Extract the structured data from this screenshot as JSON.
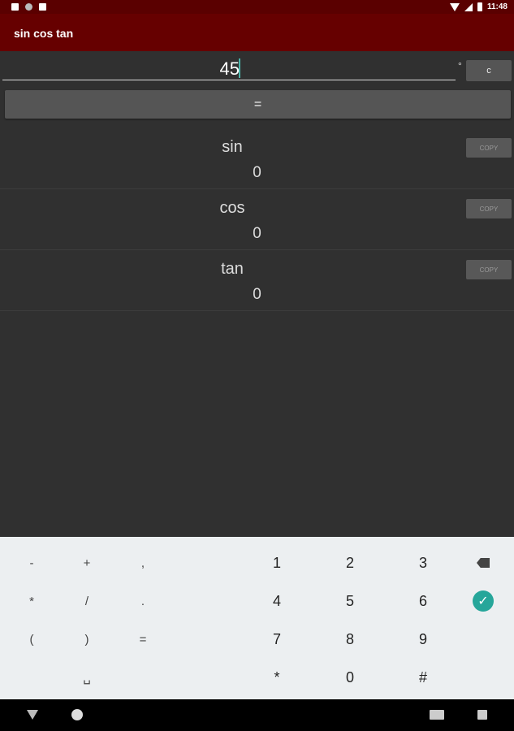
{
  "status_bar": {
    "time": "11:48"
  },
  "app": {
    "title": "sin cos tan"
  },
  "input": {
    "value": "45",
    "degree_symbol": "°",
    "clear_label": "c"
  },
  "equals_label": "=",
  "results": [
    {
      "label": "sin",
      "value": "0",
      "copy_label": "COPY"
    },
    {
      "label": "cos",
      "value": "0",
      "copy_label": "COPY"
    },
    {
      "label": "tan",
      "value": "0",
      "copy_label": "COPY"
    }
  ],
  "keyboard": {
    "rows": [
      [
        "-",
        "+",
        ",",
        "1",
        "2",
        "3"
      ],
      [
        "*",
        "/",
        ".",
        "4",
        "5",
        "6"
      ],
      [
        "(",
        ")",
        "=",
        "7",
        "8",
        "9"
      ],
      [
        "␣",
        "*",
        "0",
        "#"
      ]
    ],
    "done_icon": "check-icon",
    "backspace_icon": "backspace-icon"
  },
  "colors": {
    "app_bar": "#660000",
    "status_bar": "#5a0000",
    "background": "#303030",
    "accent": "#26a69a"
  }
}
